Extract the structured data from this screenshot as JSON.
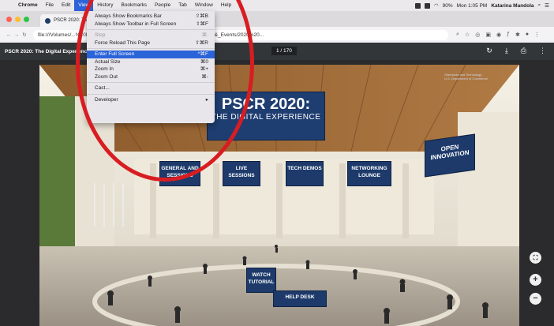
{
  "menubar": {
    "apple": "",
    "items": [
      "Chrome",
      "File",
      "Edit",
      "View",
      "History",
      "Bookmarks",
      "People",
      "Tab",
      "Window",
      "Help"
    ],
    "status": {
      "battery": "90%",
      "clock": "Mon 1:05 PM",
      "user": "Katarina Mandola"
    }
  },
  "tab": {
    "title": "PSCR 2020: The"
  },
  "address": {
    "url": "file:///Volumes/...%20PSCR%20PM0%20(2017-2022)/Graphics/Conferences_&_Events/2020%20..."
  },
  "pdf": {
    "title": "PSCR 2020: The Digital Experience",
    "page": "1 / 170"
  },
  "view_menu": {
    "items": [
      {
        "label": "Always Show Bookmarks Bar",
        "shortcut": "⇧⌘B"
      },
      {
        "label": "Always Show Toolbar in Full Screen",
        "shortcut": "⇧⌘F"
      },
      {
        "label": "Stop",
        "shortcut": "⌘."
      },
      {
        "label": "Force Reload This Page",
        "shortcut": "⇧⌘R"
      },
      {
        "label": "Enter Full Screen",
        "shortcut": "^⌘F"
      },
      {
        "label": "Actual Size",
        "shortcut": "⌘0"
      },
      {
        "label": "Zoom In",
        "shortcut": "⌘+"
      },
      {
        "label": "Zoom Out",
        "shortcut": "⌘-"
      },
      {
        "label": "Cast...",
        "shortcut": ""
      },
      {
        "label": "Developer",
        "shortcut": "▸"
      }
    ]
  },
  "slide": {
    "banner_line1": "PSCR 2020:",
    "banner_line2": "THE DIGITAL EXPERIENCE",
    "signs": [
      "GENERAL AND SESSIONS",
      "LIVE SESSIONS",
      "TECH DEMOS",
      "NETWORKING LOUNGE"
    ],
    "open_innovation": "OPEN INNOVATION",
    "tutorial": "WATCH TUTORIAL",
    "help_desk": "HELP DESK",
    "nist_line1": "Standards and Technology",
    "nist_line2": "U.S. Department of Commerce"
  },
  "colors": {
    "highlight": "#2b63d9",
    "annotation_ring": "#d81d22",
    "sign_blue": "#1d3a6b"
  }
}
